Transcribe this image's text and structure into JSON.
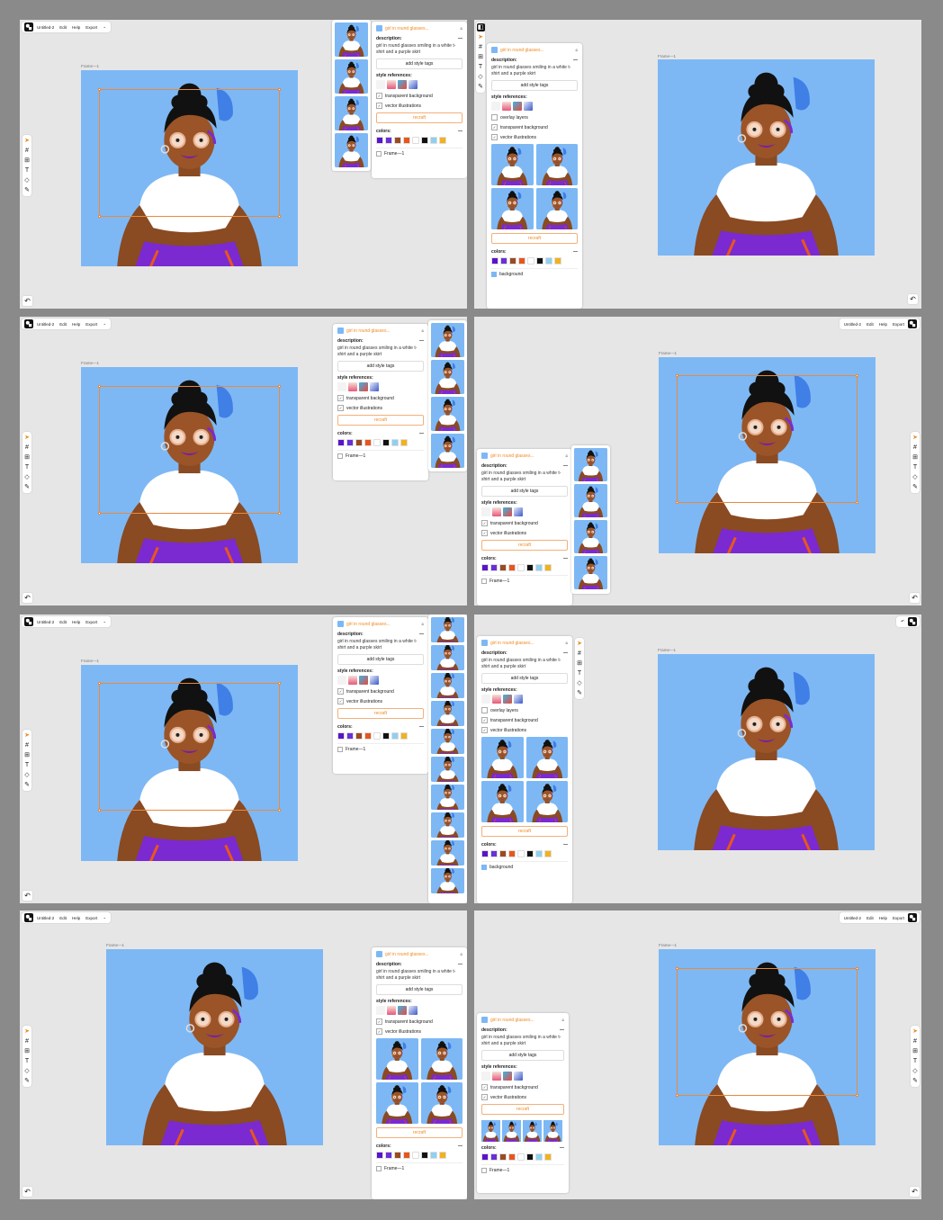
{
  "menu": {
    "file_name": "Untitled-2",
    "edit": "Edit",
    "help": "Help",
    "export": "Export",
    "chevron": "⌄"
  },
  "frame_name": "Frame—1",
  "panel": {
    "title": "girl in round glasses...",
    "description_label": "description:",
    "description_text": "girl in round glasses smiling in a white t-shirt and a purple skirt",
    "add_style_tags": "add style tags",
    "style_references_label": "style references:",
    "overlay_layers": "overlay layers",
    "transparent_background": "transparent background",
    "vector_illustrations": "vector illustrations",
    "recraft": "recraft",
    "colors_label": "colors:",
    "background_label": "background",
    "collapse": "—"
  },
  "colors": [
    "#5a14c8",
    "#6a2fd9",
    "#9b4a23",
    "#e8561c",
    "#ffffff",
    "#111111",
    "#8fd0f0",
    "#f2b21b"
  ],
  "accent": "#f08a24",
  "canvas_bg": "#7db8f5",
  "icons": [
    "select-icon",
    "frame-icon",
    "add-icon",
    "text-icon",
    "eraser-icon",
    "pen-icon",
    "undo-icon",
    "lock-icon"
  ]
}
